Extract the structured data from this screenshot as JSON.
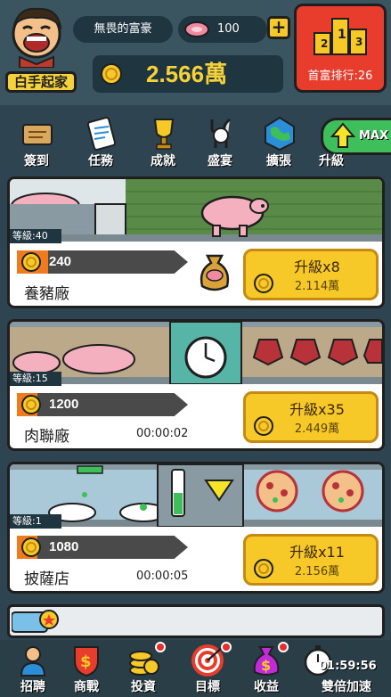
{
  "header": {
    "player_name": "無畏的富豪",
    "title": "白手起家",
    "meat_count": "100",
    "plus_label": "+",
    "money": "2.566萬",
    "rank_label": "首富排行:26"
  },
  "functions": [
    {
      "label": "簽到",
      "icon": "scroll-icon"
    },
    {
      "label": "任務",
      "icon": "clipboard-icon"
    },
    {
      "label": "成就",
      "icon": "trophy-icon"
    },
    {
      "label": "盛宴",
      "icon": "cutlery-icon"
    },
    {
      "label": "擴張",
      "icon": "globe-icon"
    }
  ],
  "upgrade": {
    "label": "升級",
    "max": "MAX",
    "icon": "arrow-up-icon"
  },
  "businesses": [
    {
      "level": "等級:40",
      "production": "240",
      "progress": 0.18,
      "name": "養豬廠",
      "timer": "",
      "upgrade_label": "升級x8",
      "upgrade_cost": "2.114萬"
    },
    {
      "level": "等級:15",
      "production": "1200",
      "progress": 0.12,
      "name": "肉聯廠",
      "timer": "00:00:02",
      "upgrade_label": "升級x35",
      "upgrade_cost": "2.449萬"
    },
    {
      "level": "等級:1",
      "production": "1080",
      "progress": 0.12,
      "name": "披薩店",
      "timer": "00:00:05",
      "upgrade_label": "升級x11",
      "upgrade_cost": "2.156萬"
    }
  ],
  "nav": [
    {
      "label": "招聘",
      "icon": "recruit-icon",
      "badge": false
    },
    {
      "label": "商戰",
      "icon": "dollar-shield-icon",
      "badge": false
    },
    {
      "label": "投資",
      "icon": "coins-icon",
      "badge": true
    },
    {
      "label": "目標",
      "icon": "target-icon",
      "badge": true
    },
    {
      "label": "收益",
      "icon": "money-bag-icon",
      "badge": true
    },
    {
      "label": "雙倍加速",
      "icon": "stopwatch-icon",
      "badge": false
    }
  ],
  "boost_timer": "01:59:56",
  "colors": {
    "accent_yellow": "#f6c928",
    "money_yellow": "#f6d23a",
    "rank_red": "#e83c2c",
    "upgrade_green": "#3fbe5c",
    "progress_orange": "#f07b1f"
  }
}
